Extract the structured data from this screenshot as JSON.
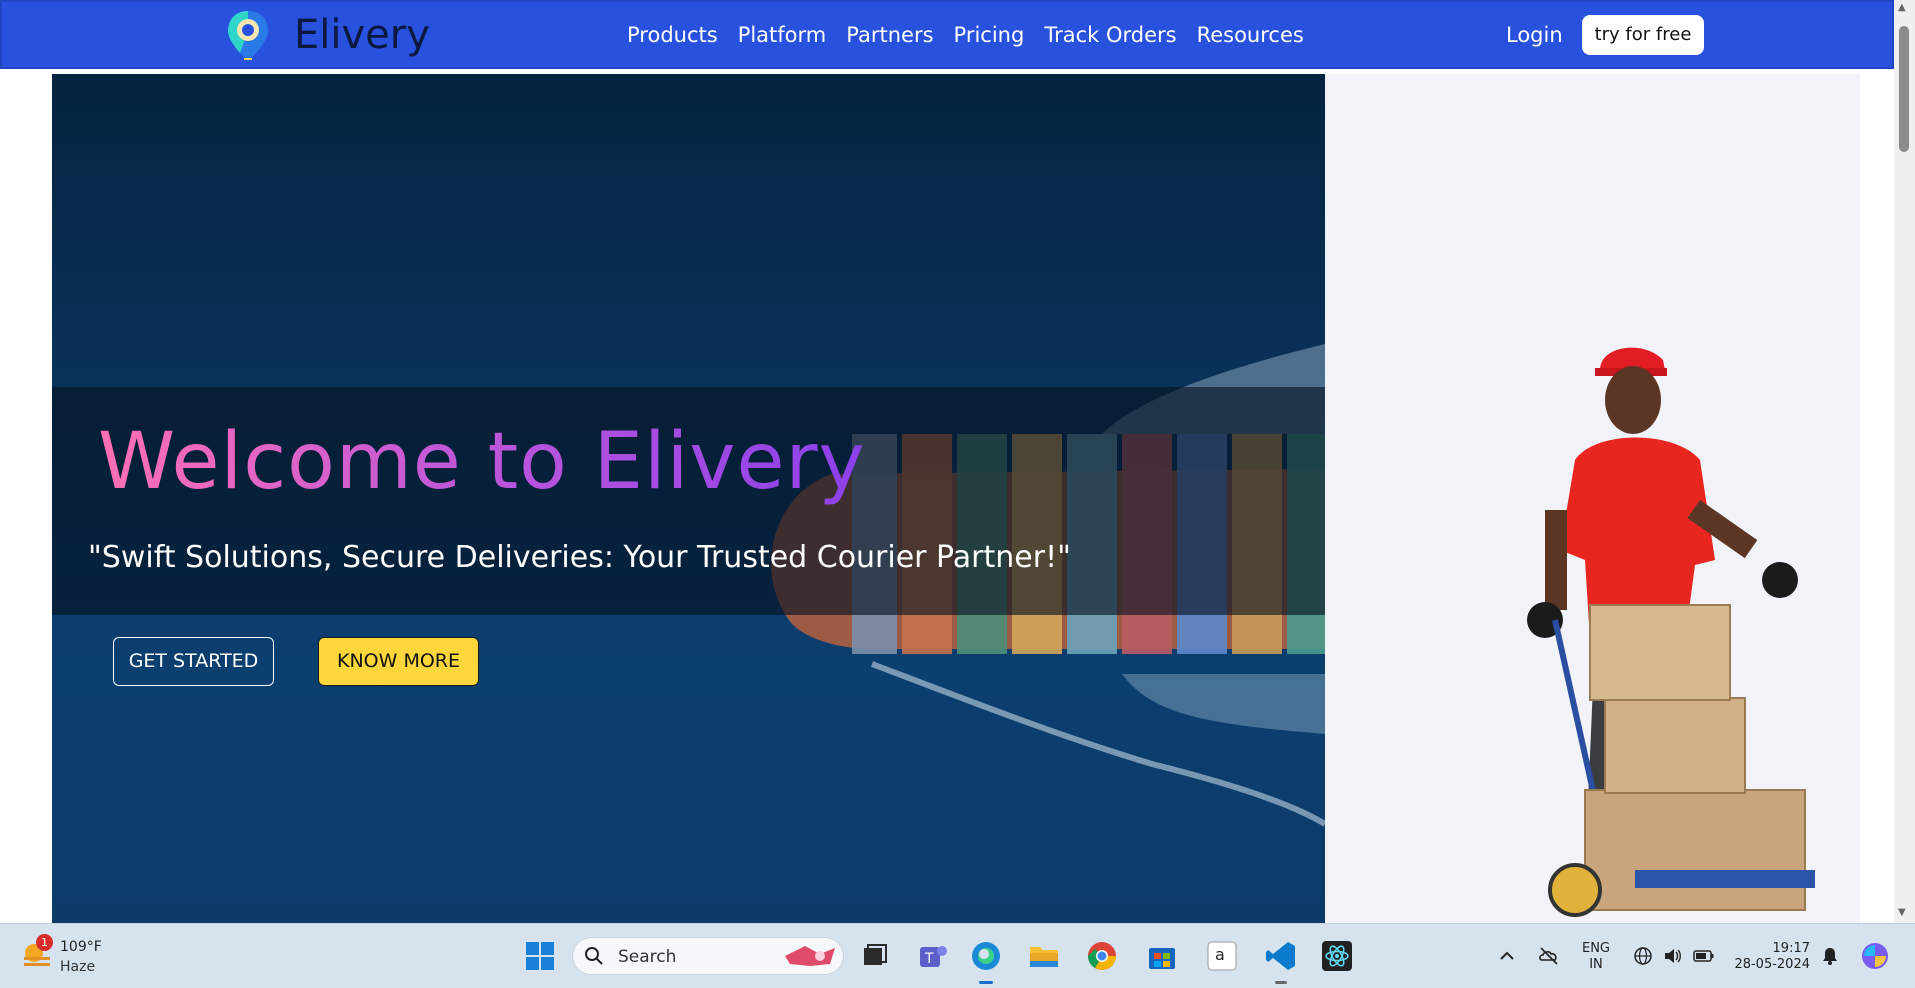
{
  "brand": {
    "name": "Elivery"
  },
  "nav": {
    "links": [
      "Products",
      "Platform",
      "Partners",
      "Pricing",
      "Track Orders",
      "Resources"
    ],
    "login": "Login",
    "try_free": "try for free"
  },
  "hero": {
    "title": "Welcome to Elivery",
    "tagline": "\"Swift Solutions, Secure Deliveries: Your Trusted Courier Partner!\"",
    "get_started": "GET STARTED",
    "know_more": "KNOW MORE"
  },
  "taskbar": {
    "weather_temp": "109°F",
    "weather_condition": "Haze",
    "weather_badge": "1",
    "search_placeholder": "Search",
    "lang_line1": "ENG",
    "lang_line2": "IN",
    "time": "19:17",
    "date": "28-05-2024"
  },
  "colors": {
    "navbar": "#2852dd",
    "know_more_bg": "#fcd63b",
    "title_gradient_start": "#ff6fb3",
    "title_gradient_end": "#8b40ea"
  }
}
